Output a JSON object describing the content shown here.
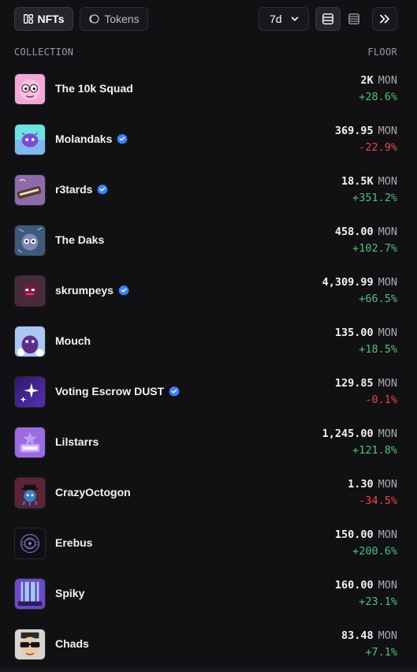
{
  "tabs": {
    "nfts_label": "NFTs",
    "tokens_label": "Tokens"
  },
  "period": {
    "selected": "7d"
  },
  "table": {
    "col_collection": "COLLECTION",
    "col_floor": "FLOOR",
    "rows": [
      {
        "name": "The 10k Squad",
        "verified": false,
        "floor": "2K",
        "unit": "MON",
        "change": "+28.6%",
        "trend": "up"
      },
      {
        "name": "Molandaks",
        "verified": true,
        "floor": "369.95",
        "unit": "MON",
        "change": "-22.9%",
        "trend": "down"
      },
      {
        "name": "r3tards",
        "verified": true,
        "floor": "18.5K",
        "unit": "MON",
        "change": "+351.2%",
        "trend": "up"
      },
      {
        "name": "The Daks",
        "verified": false,
        "floor": "458.00",
        "unit": "MON",
        "change": "+102.7%",
        "trend": "up"
      },
      {
        "name": "skrumpeys",
        "verified": true,
        "floor": "4,309.99",
        "unit": "MON",
        "change": "+66.5%",
        "trend": "up"
      },
      {
        "name": "Mouch",
        "verified": false,
        "floor": "135.00",
        "unit": "MON",
        "change": "+18.5%",
        "trend": "up"
      },
      {
        "name": "Voting Escrow DUST",
        "verified": true,
        "floor": "129.85",
        "unit": "MON",
        "change": "-0.1%",
        "trend": "down"
      },
      {
        "name": "Lilstarrs",
        "verified": false,
        "floor": "1,245.00",
        "unit": "MON",
        "change": "+121.8%",
        "trend": "up"
      },
      {
        "name": "CrazyOctogon",
        "verified": false,
        "floor": "1.30",
        "unit": "MON",
        "change": "-34.5%",
        "trend": "down"
      },
      {
        "name": "Erebus",
        "verified": false,
        "floor": "150.00",
        "unit": "MON",
        "change": "+200.6%",
        "trend": "up"
      },
      {
        "name": "Spiky",
        "verified": false,
        "floor": "160.00",
        "unit": "MON",
        "change": "+23.1%",
        "trend": "up"
      },
      {
        "name": "Chads",
        "verified": false,
        "floor": "83.48",
        "unit": "MON",
        "change": "+7.1%",
        "trend": "up"
      }
    ]
  },
  "colors": {
    "background": "#111013",
    "positive": "#4ec27a",
    "negative": "#e5484d",
    "verified": "#3b82f6"
  }
}
